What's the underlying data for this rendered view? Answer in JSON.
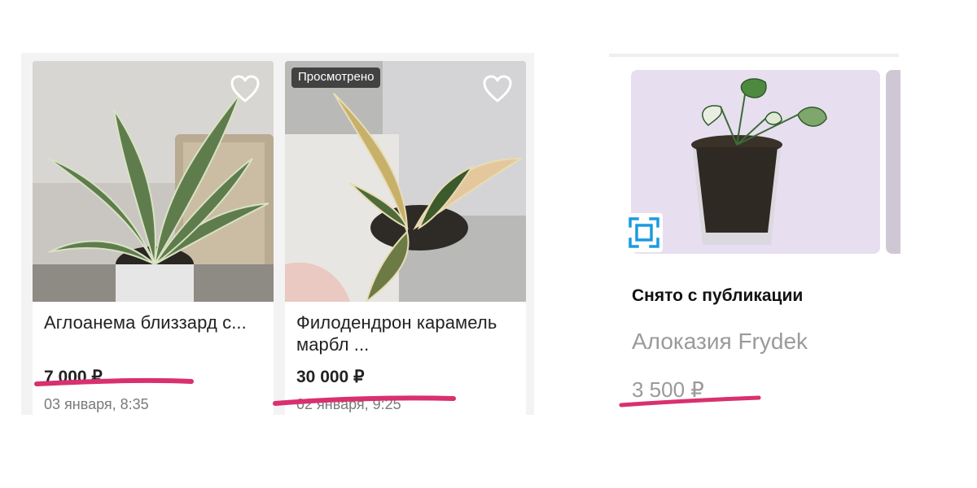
{
  "listings": [
    {
      "title": "Аглоанема близзард с...",
      "price": "7 000 ₽",
      "date": "03 января, 8:35",
      "favorite_icon": "heart-outline-icon"
    },
    {
      "badge": "Просмотрено",
      "title": "Филодендрон карамель марбл ...",
      "price": "30 000 ₽",
      "date": "02 января, 9:25",
      "favorite_icon": "heart-outline-icon"
    }
  ],
  "archived_listing": {
    "status": "Снято с публикации",
    "title": "Алоказия Frydek",
    "price": "3 500 ₽",
    "scan_icon": "scan-frame-icon"
  },
  "colors": {
    "highlight": "#d9306f",
    "price_text": "#222222",
    "muted_text": "#9a9a9a",
    "scan_icon": "#1a9be0"
  }
}
